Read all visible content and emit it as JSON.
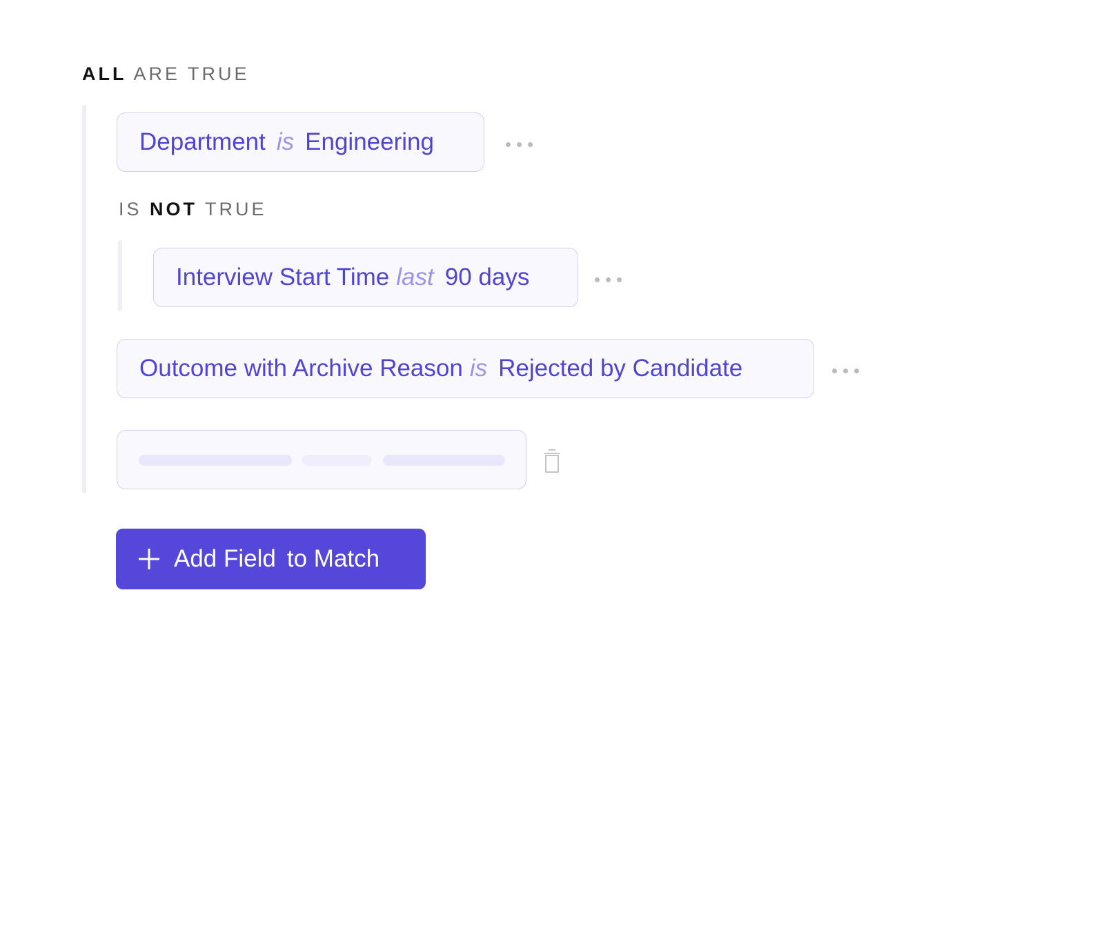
{
  "root_group": {
    "quantifier": "ALL",
    "suffix": "ARE TRUE"
  },
  "conditions": [
    {
      "field": "Department",
      "operator": "is",
      "value": "Engineering"
    }
  ],
  "nested_group": {
    "prefix": "IS",
    "quantifier": "NOT",
    "suffix": "TRUE",
    "conditions": [
      {
        "field": "Interview Start Time",
        "operator": "last",
        "value": "90 days"
      }
    ]
  },
  "conditions_after": [
    {
      "field": "Outcome with Archive Reason",
      "operator": "is",
      "value": "Rejected by Candidate"
    }
  ],
  "placeholder_condition": {
    "state": "loading"
  },
  "add_button": {
    "label_part1": "Add Field",
    "label_part2": "to Match",
    "icon": "plus-icon"
  },
  "icons": {
    "more": "more-horizontal-icon",
    "delete": "trash-icon"
  },
  "colors": {
    "accent": "#5447d9",
    "chip_text": "#5044d4",
    "operator_text": "#9d92ea",
    "chip_border": "#d4d0f5",
    "chip_bg": "#f9f8fe"
  }
}
